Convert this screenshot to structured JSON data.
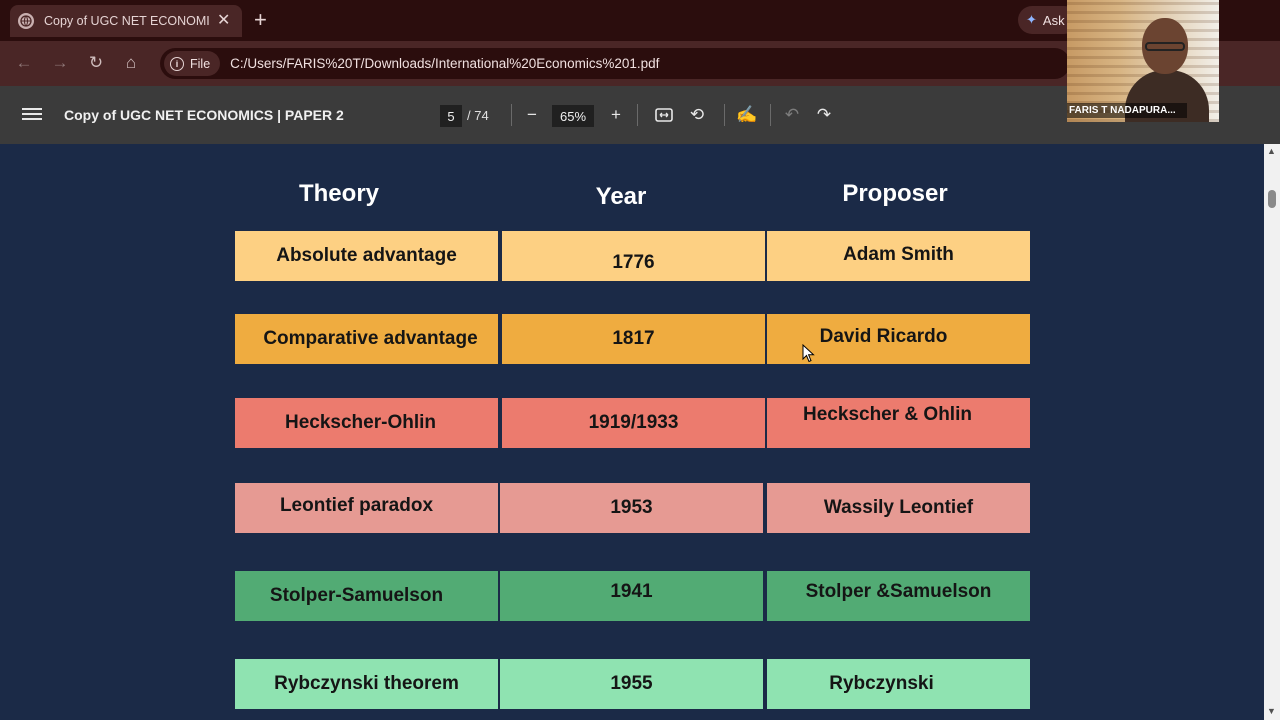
{
  "browser": {
    "tab_title": "Copy of UGC NET ECONOMICS",
    "tab_close": "✕",
    "new_tab": "+",
    "ask_label": "Ask",
    "file_chip": "File",
    "url": "C:/Users/FARIS%20T/Downloads/International%20Economics%201.pdf"
  },
  "pdf_toolbar": {
    "title": "Copy of UGC NET ECONOMICS | PAPER 2",
    "page_current": "5",
    "page_total": "/ 74",
    "zoom": "65%"
  },
  "webcam": {
    "name": "FARIS T NADAPURA..."
  },
  "table": {
    "headers": [
      "Theory",
      "Year",
      "Proposer"
    ],
    "rows": [
      {
        "theory": "Absolute advantage",
        "year": "1776",
        "proposer": "Adam Smith",
        "color": "#fdd083"
      },
      {
        "theory": "Comparative advantage",
        "year": "1817",
        "proposer": "David Ricardo",
        "color": "#efac40"
      },
      {
        "theory": "Heckscher-Ohlin",
        "year": "1919/1933",
        "proposer": "Heckscher & Ohlin",
        "color": "#ec7b6e"
      },
      {
        "theory": "Leontief paradox",
        "year": "1953",
        "proposer": "Wassily Leontief",
        "color": "#e69a93"
      },
      {
        "theory": "Stolper-Samuelson",
        "year": "1941",
        "proposer": "Stolper &Samuelson",
        "color": "#52ab74"
      },
      {
        "theory": "Rybczynski theorem",
        "year": "1955",
        "proposer": "Rybczynski",
        "color": "#8fe3b1"
      }
    ]
  }
}
